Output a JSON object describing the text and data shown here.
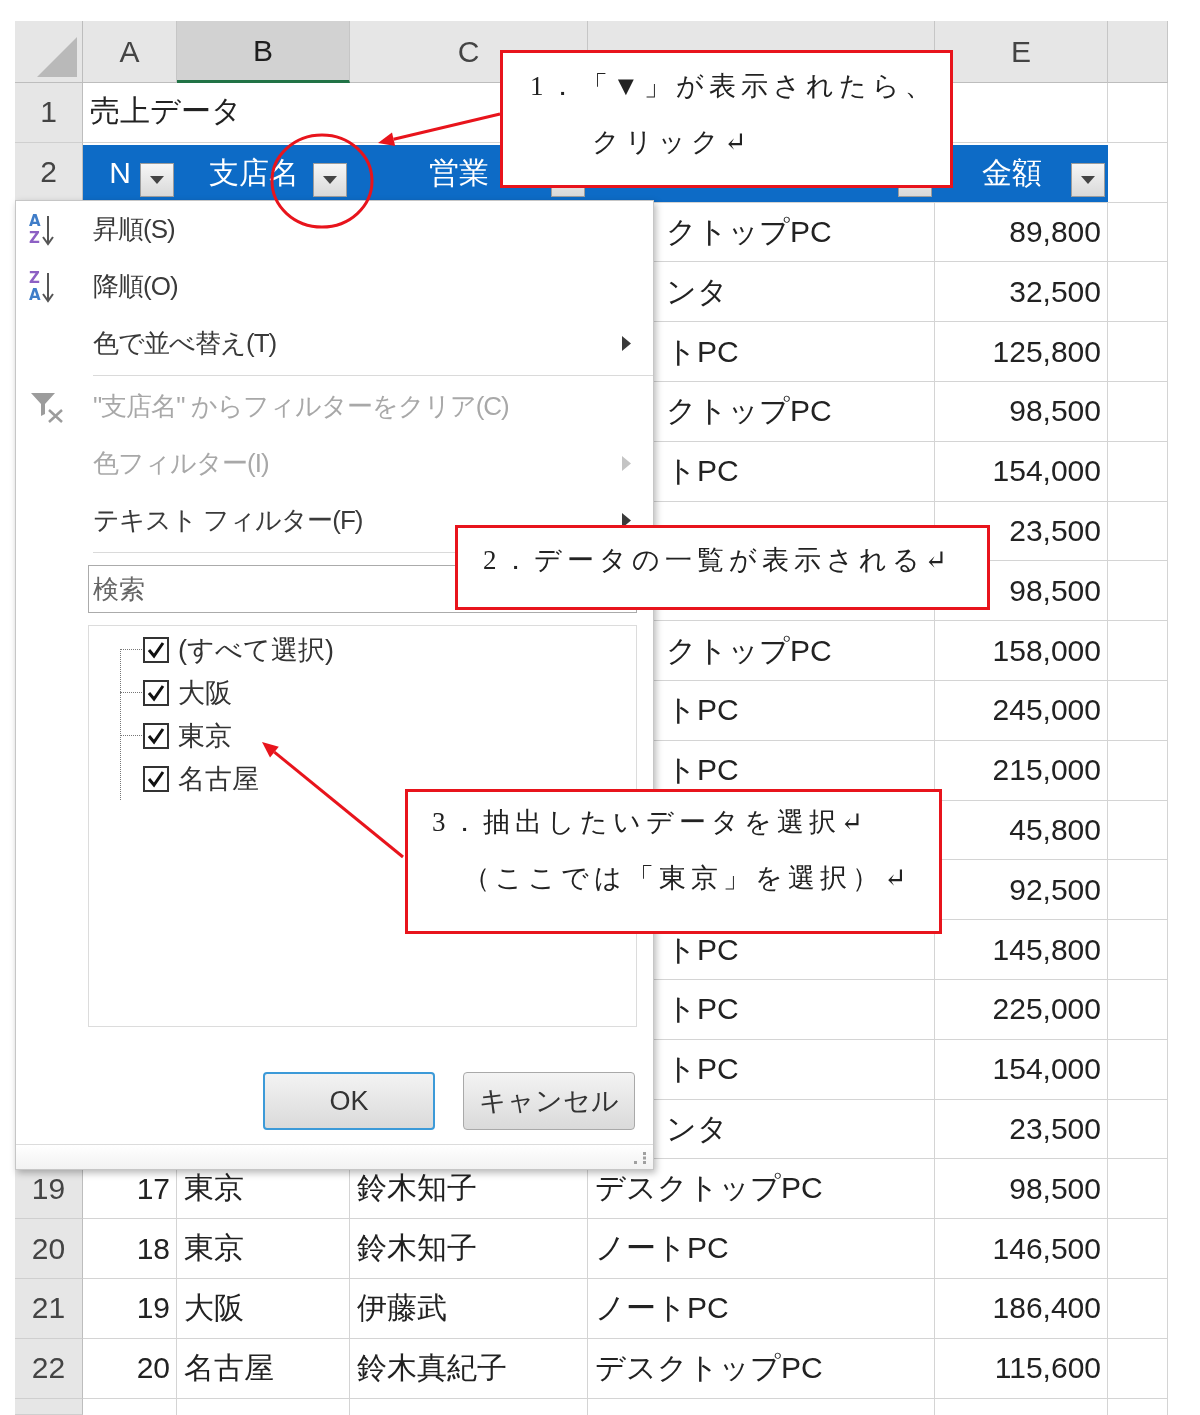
{
  "sheet": {
    "column_headers": [
      {
        "label": "A",
        "selected": false
      },
      {
        "label": "B",
        "selected": true
      },
      {
        "label": "C",
        "selected": false
      },
      {
        "selected": false
      },
      {
        "label": "E",
        "selected": false
      },
      {
        "selected": false
      }
    ],
    "title_row": {
      "row_header": "1",
      "title": "売上データ"
    },
    "header_row": {
      "row_header": "2",
      "cells": [
        {
          "label": "N",
          "filter_button": true
        },
        {
          "label": "支店名",
          "filter_button": true
        },
        {
          "label": "営業",
          "filter_button": true
        },
        {
          "filter_button": true
        },
        {
          "label": "金額",
          "filter_button": true
        }
      ]
    },
    "covered_rows": [
      {
        "column_d": "クトップPC",
        "column_e": "89,800"
      },
      {
        "column_d": "ンタ",
        "column_e": "32,500"
      },
      {
        "column_d": "トPC",
        "column_e": "125,800"
      },
      {
        "column_d": "クトップPC",
        "column_e": "98,500"
      },
      {
        "column_d": "トPC",
        "column_e": "154,000"
      },
      {
        "column_e": "23,500"
      },
      {
        "column_e": "98,500"
      },
      {
        "column_d": "クトップPC",
        "column_e": "158,000"
      },
      {
        "column_d": "トPC",
        "column_e": "245,000"
      },
      {
        "column_d": "トPC",
        "column_e": "215,000"
      },
      {
        "column_e": "45,800"
      },
      {
        "column_e": "92,500"
      },
      {
        "column_d": "トPC",
        "column_e": "145,800"
      },
      {
        "column_d": "トPC",
        "column_e": "225,000"
      },
      {
        "column_d": "トPC",
        "column_e": "154,000"
      },
      {
        "column_d": "ンタ",
        "column_e": "23,500"
      }
    ],
    "rows": [
      {
        "row_header": "19",
        "cells": [
          "17",
          "東京",
          "鈴木知子",
          "デスクトップPC",
          "98,500"
        ]
      },
      {
        "row_header": "20",
        "cells": [
          "18",
          "東京",
          "鈴木知子",
          "ノートPC",
          "146,500"
        ]
      },
      {
        "row_header": "21",
        "cells": [
          "19",
          "大阪",
          "伊藤武",
          "ノートPC",
          "186,400"
        ]
      },
      {
        "row_header": "22",
        "cells": [
          "20",
          "名古屋",
          "鈴木真紀子",
          "デスクトップPC",
          "115,600"
        ]
      }
    ]
  },
  "filter_menu": {
    "items": [
      {
        "kind": "sort_asc",
        "icon_letters": [
          "A",
          "Z"
        ],
        "label": "昇順(S)",
        "disabled": false,
        "submenu": false
      },
      {
        "kind": "sort_desc",
        "icon_letters": [
          "Z",
          "A"
        ],
        "label": "降順(O)",
        "disabled": false,
        "submenu": false
      },
      {
        "kind": "plain",
        "label": "色で並べ替え(T)",
        "disabled": false,
        "submenu": true
      },
      {
        "kind": "separator"
      },
      {
        "kind": "clear_filter",
        "label": "\"支店名\" からフィルターをクリア(C)",
        "disabled": true,
        "submenu": false
      },
      {
        "kind": "plain",
        "label": "色フィルター(I)",
        "disabled": true,
        "submenu": true
      },
      {
        "kind": "plain",
        "label": "テキスト フィルター(F)",
        "disabled": false,
        "submenu": true
      },
      {
        "kind": "separator"
      }
    ],
    "search": {
      "placeholder": "検索"
    },
    "options": [
      {
        "label": "(すべて選択)",
        "checked": true
      },
      {
        "label": "大阪",
        "checked": true
      },
      {
        "label": "東京",
        "checked": true
      },
      {
        "label": "名古屋",
        "checked": true
      }
    ],
    "buttons": [
      {
        "label": "OK",
        "default": true
      },
      {
        "label": "キャンセル",
        "default": false
      }
    ]
  },
  "callouts": [
    {
      "lines": [
        "1．「▼」が表示されたら、",
        "クリック↵"
      ]
    },
    {
      "lines": [
        "2．データの一覧が表示される↵"
      ]
    },
    {
      "lines": [
        "3．抽出したいデータを選択↵",
        "（ここでは「東京」を選択）↵"
      ]
    }
  ]
}
